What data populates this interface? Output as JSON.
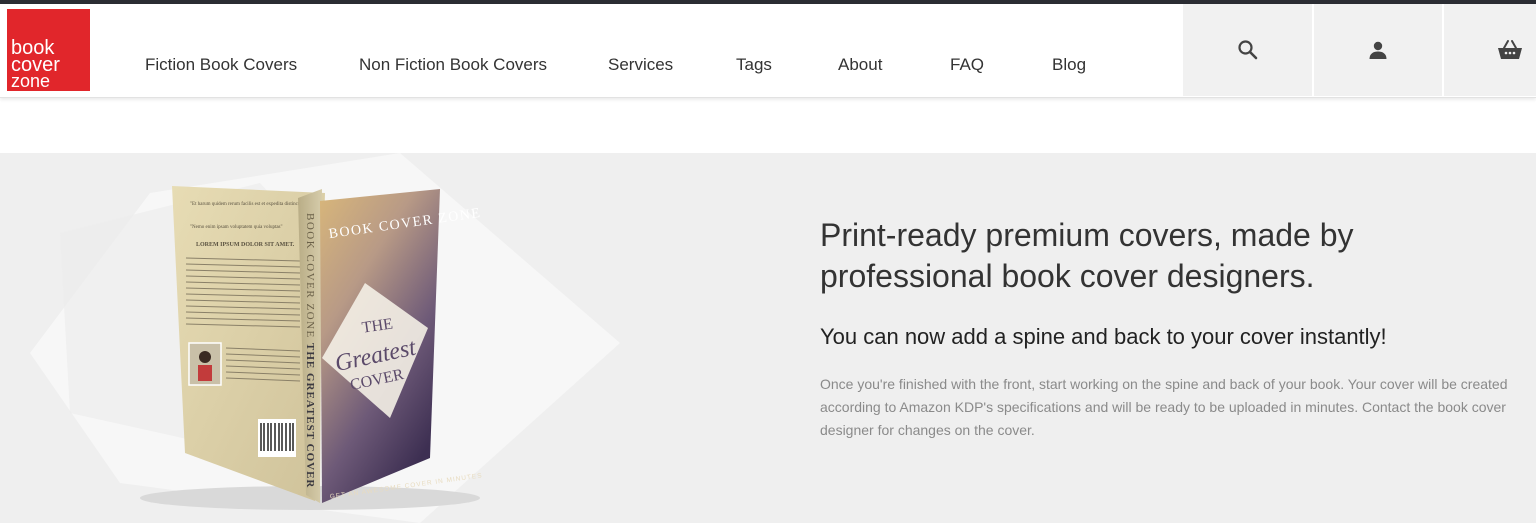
{
  "brand": {
    "line1": "book",
    "line2": "cover",
    "line3": "zone",
    "color": "#e1262b"
  },
  "nav": [
    {
      "label": "Fiction Book Covers"
    },
    {
      "label": "Non Fiction Book Covers"
    },
    {
      "label": "Services"
    },
    {
      "label": "Tags"
    },
    {
      "label": "About"
    },
    {
      "label": "FAQ"
    },
    {
      "label": "Blog"
    }
  ],
  "header_icons": [
    "search-icon",
    "user-icon",
    "basket-icon"
  ],
  "hero": {
    "title": "Print-ready premium covers, made by professional book cover designers.",
    "subtitle": "You can now add a spine and back to your cover instantly!",
    "body": "Once you're finished with the front, start working on the spine and back of your book. Your cover will be created according to Amazon KDP's specifications and will be ready to be uploaded in minutes. Contact the book cover designer for changes on the cover."
  },
  "book": {
    "front_brand": "BOOK COVER ZONE",
    "front_the": "THE",
    "front_greatest": "Greatest",
    "front_cover": "COVER",
    "front_tagline": "GET AN AWESOME COVER IN MINUTES",
    "spine_brand": "BOOK COVER ZONE",
    "spine_title": "THE GREATEST COVER",
    "back_heading": "LOREM IPSUM DOLOR SIT AMET."
  }
}
